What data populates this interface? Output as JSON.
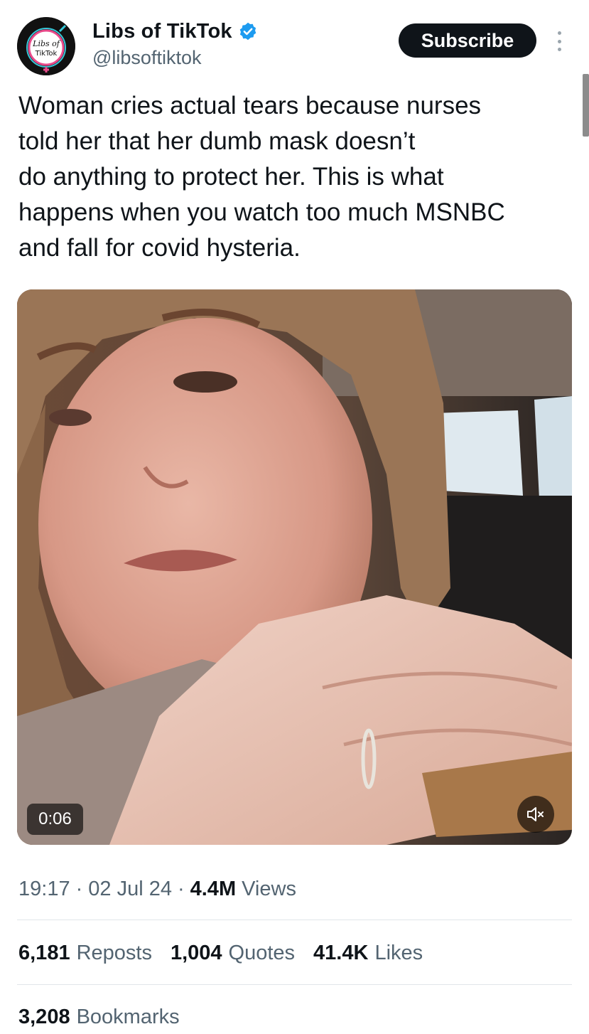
{
  "author": {
    "display_name": "Libs of TikTok",
    "handle": "@libsoftiktok",
    "avatar_text_line1": "Libs of",
    "avatar_text_line2": "TikTok",
    "verified": true
  },
  "header": {
    "subscribe_label": "Subscribe"
  },
  "tweet": {
    "text_lines": [
      "Woman cries actual tears because nurses",
      "told her that her dumb mask doesn’t",
      "do anything to protect her. This is what",
      "happens when you watch too much MSNBC",
      "and fall for covid hysteria."
    ]
  },
  "media": {
    "type": "video",
    "duration": "0:06",
    "muted": true
  },
  "meta": {
    "time": "19:17",
    "date": "02 Jul 24",
    "separator": "·",
    "views_count": "4.4M",
    "views_label": "Views"
  },
  "stats": {
    "reposts_count": "6,181",
    "reposts_label": "Reposts",
    "quotes_count": "1,004",
    "quotes_label": "Quotes",
    "likes_count": "41.4K",
    "likes_label": "Likes",
    "bookmarks_count": "3,208",
    "bookmarks_label": "Bookmarks"
  },
  "colors": {
    "text_primary": "#0f1419",
    "text_secondary": "#536471",
    "verified_blue": "#1d9bf0",
    "button_bg": "#0f1419",
    "divider": "#e1e6ea"
  },
  "icons": {
    "verified": "verified-badge-icon",
    "more": "more-vertical-icon",
    "mute": "speaker-muted-icon"
  }
}
